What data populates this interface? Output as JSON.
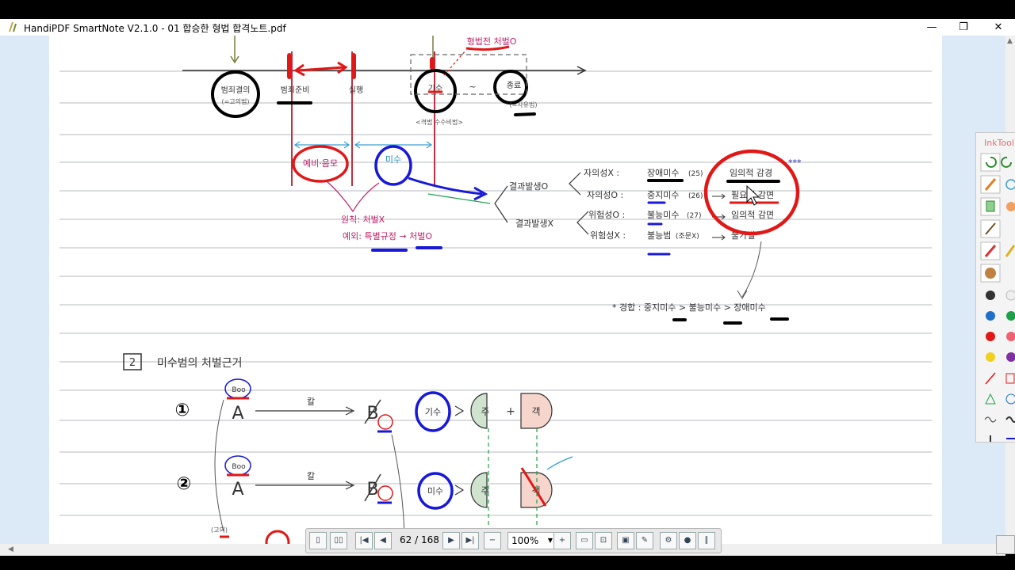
{
  "window": {
    "title": "HandiPDF SmartNote V2.1.0 - 01 합승한 형법 합격노트.pdf",
    "minimize": "—",
    "restore": "❐",
    "close": "✕"
  },
  "note": {
    "timeline": {
      "stages": [
        "범죄결의",
        "범죄준비",
        "실행",
        "기수",
        "종료"
      ],
      "sublabels": [
        "(=고의범)",
        "(=사유범)"
      ],
      "top_label": "형법전 처벌O",
      "between": "~",
      "under_giseu": "<격범 수수비범>"
    },
    "branch1": {
      "left_circle": "예비·음모",
      "right_circle": "미수",
      "principle": "원칙: 처벌X",
      "exception": "예외: 특별규정 → 처벌O"
    },
    "branch2": {
      "result_yes": "결과발생O",
      "result_no": "결과발생X",
      "rows": [
        {
          "cond": "자의성X :",
          "name": "장애미수",
          "art": "(25)",
          "effect": "임의적 감경"
        },
        {
          "cond": "자의성O :",
          "name": "중지미수",
          "art": "(26)",
          "effect": "필요적 감면"
        },
        {
          "cond": "위험성O :",
          "name": "불능미수",
          "art": "(27)",
          "effect": "임의적 감면"
        },
        {
          "cond": "위험성X :",
          "name": "불능범",
          "art": "(조문X)",
          "effect": "불가벌"
        }
      ],
      "stars": "***",
      "compare": "* 경합 : 중지미수 > 불능미수 > 장애미수"
    },
    "section": {
      "number": "2",
      "title": "미수범의 처벌근거",
      "case_a_marker": "①",
      "case_b_marker": "②",
      "actor": "A",
      "victim": "B",
      "weapon": "칼",
      "case_a_result": "기수",
      "case_b_result": "미수",
      "subjective": "주",
      "objective": "객",
      "plus": "+",
      "bo": "Boo",
      "small_note": "(고의)"
    }
  },
  "toolbar": {
    "page_indicator": "62 / 168",
    "zoom": "100%"
  },
  "inktool": {
    "title": "InkTool"
  },
  "colors": {
    "red_ink": "#e01818",
    "blue_ink": "#1818d8",
    "pink_ink": "#c0206a",
    "green_ink": "#1ea04a",
    "panel_bg": "#dce9f6"
  }
}
